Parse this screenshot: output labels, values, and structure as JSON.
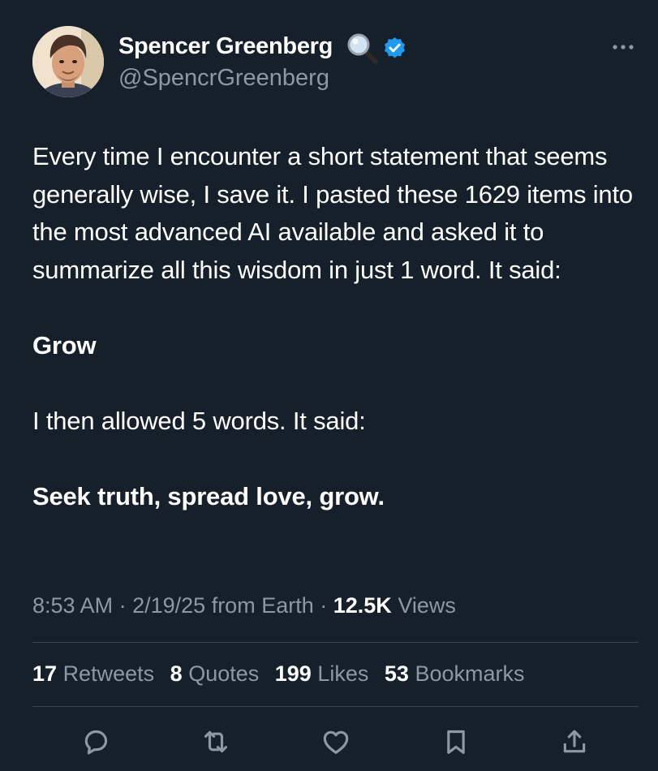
{
  "author": {
    "display_name": "Spencer Greenberg",
    "name_emoji": "magnifying-glass-icon",
    "verified": true,
    "handle": "@SpencrGreenberg"
  },
  "tweet": {
    "paragraphs": [
      "Every time I encounter a short statement that seems generally wise, I save it. I pasted these 1629 items into the most advanced AI available and asked it to summarize all this wisdom in just 1 word. It said:",
      "Grow",
      "I then allowed 5 words. It said:",
      "Seek truth, spread love, grow."
    ]
  },
  "meta": {
    "time": "8:53 AM",
    "date": "2/19/25",
    "source": "from Earth",
    "views_count": "12.5K",
    "views_label": "Views"
  },
  "stats": {
    "retweets": {
      "count": "17",
      "label": "Retweets"
    },
    "quotes": {
      "count": "8",
      "label": "Quotes"
    },
    "likes": {
      "count": "199",
      "label": "Likes"
    },
    "bookmarks": {
      "count": "53",
      "label": "Bookmarks"
    }
  },
  "actions": [
    "reply-icon",
    "retweet-icon",
    "like-icon",
    "bookmark-icon",
    "share-icon"
  ],
  "colors": {
    "background": "#15202b",
    "text_primary": "#ffffff",
    "text_secondary": "#8b98a5",
    "divider": "#38444d",
    "verified": "#1d9bf0"
  }
}
